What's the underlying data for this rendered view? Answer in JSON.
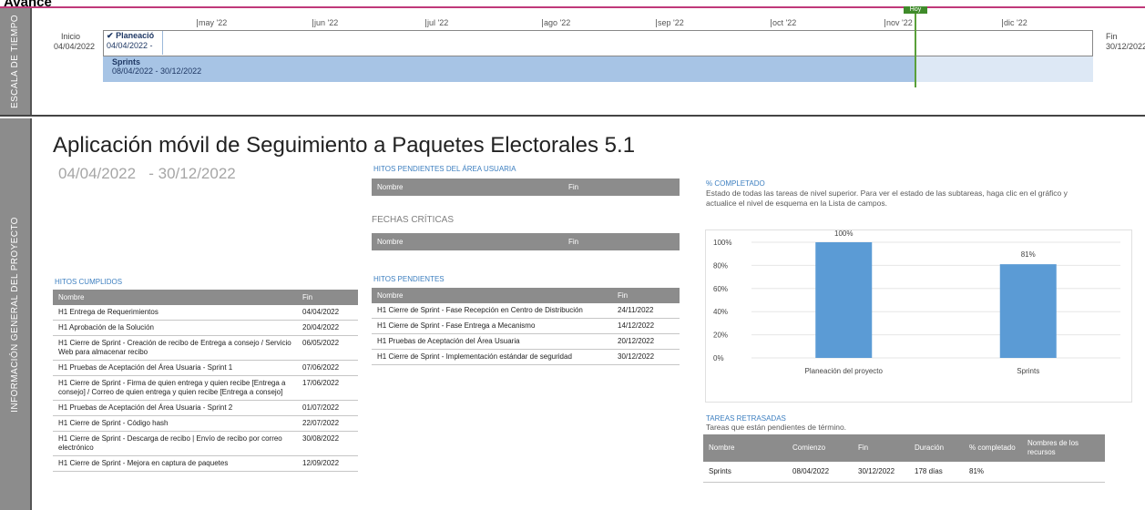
{
  "page_title": "Avance",
  "timescale": {
    "side_label": "ESCALA DE TIEMPO",
    "today_label": "Hoy",
    "start_label": "Inicio",
    "start_date": "04/04/2022",
    "end_label": "Fin",
    "end_date": "30/12/2022",
    "months": [
      "may '22",
      "jun '22",
      "jul '22",
      "ago '22",
      "sep '22",
      "oct '22",
      "nov '22",
      "dic '22"
    ],
    "milestone_title": "Planeació",
    "milestone_date": "04/04/2022 -",
    "bar_title": "Sprints",
    "bar_dates": "08/04/2022 - 30/12/2022"
  },
  "info": {
    "side_label": "INFORMACIÓN GENERAL DEL PROYECTO",
    "project_title": "Aplicación móvil de Seguimiento a Paquetes Electorales 5.1",
    "start": "04/04/2022",
    "end": "- 30/12/2022",
    "hitos_user_label": "HITOS PENDIENTES DEL ÁREA USUARIA",
    "fechas_label": "FECHAS CRÍTICAS",
    "col_nombre": "Nombre",
    "col_fin": "Fin",
    "hitos_cumplidos_label": "HITOS CUMPLIDOS",
    "hitos_cumplidos": [
      {
        "name": "H1 Entrega de Requerimientos",
        "fin": "04/04/2022"
      },
      {
        "name": "H1 Aprobación de la Solución",
        "fin": "20/04/2022"
      },
      {
        "name": "H1 Cierre de Sprint - Creación de recibo de Entrega a consejo / Servicio Web para almacenar recibo",
        "fin": "06/05/2022"
      },
      {
        "name": "H1 Pruebas de Aceptación del Área Usuaria - Sprint 1",
        "fin": "07/06/2022"
      },
      {
        "name": "H1 Cierre de Sprint - Firma de quien entrega y quien recibe [Entrega a consejo] / Correo de quien entrega y quien recibe [Entrega a consejo]",
        "fin": "17/06/2022"
      },
      {
        "name": "H1 Pruebas de Aceptación del Área Usuaria - Sprint 2",
        "fin": "01/07/2022"
      },
      {
        "name": "H1 Cierre de Sprint - Código hash",
        "fin": "22/07/2022"
      },
      {
        "name": "H1 Cierre de Sprint - Descarga de recibo | Envío de recibo por correo electrónico",
        "fin": "30/08/2022"
      },
      {
        "name": "H1 Cierre de Sprint - Mejora en captura de paquetes",
        "fin": "12/09/2022"
      }
    ],
    "hitos_pendientes_label": "HITOS PENDIENTES",
    "hitos_pendientes": [
      {
        "name": "H1 Cierre de Sprint - Fase Recepción en Centro de Distribución",
        "fin": "24/11/2022"
      },
      {
        "name": "H1 Cierre de Sprint - Fase Entrega a Mecanismo",
        "fin": "14/12/2022"
      },
      {
        "name": "H1 Pruebas de Aceptación del Área Usuaria",
        "fin": "20/12/2022"
      },
      {
        "name": "H1 Cierre de Sprint - Implementación estándar de seguridad",
        "fin": "30/12/2022"
      }
    ],
    "pct_label": "% COMPLETADO",
    "pct_desc": "Estado de todas las tareas de nivel superior. Para ver el estado de las subtareas, haga clic en el gráfico y actualice el nivel de esquema en la Lista de campos.",
    "retrasadas_label": "TAREAS RETRASADAS",
    "retrasadas_desc": "Tareas que están pendientes de término.",
    "retrasadas_cols": [
      "Nombre",
      "Comienzo",
      "Fin",
      "Duración",
      "% completado",
      "Nombres de los recursos"
    ],
    "retrasadas_rows": [
      [
        "Sprints",
        "08/04/2022",
        "30/12/2022",
        "178 días",
        "81%",
        ""
      ]
    ]
  },
  "chart_data": {
    "type": "bar",
    "categories": [
      "Planeación del proyecto",
      "Sprints"
    ],
    "values": [
      100,
      81
    ],
    "value_labels": [
      "100%",
      "81%"
    ],
    "y_ticks": [
      "0%",
      "20%",
      "40%",
      "60%",
      "80%",
      "100%"
    ],
    "ylim": [
      0,
      100
    ],
    "bar_color": "#5b9bd5"
  }
}
